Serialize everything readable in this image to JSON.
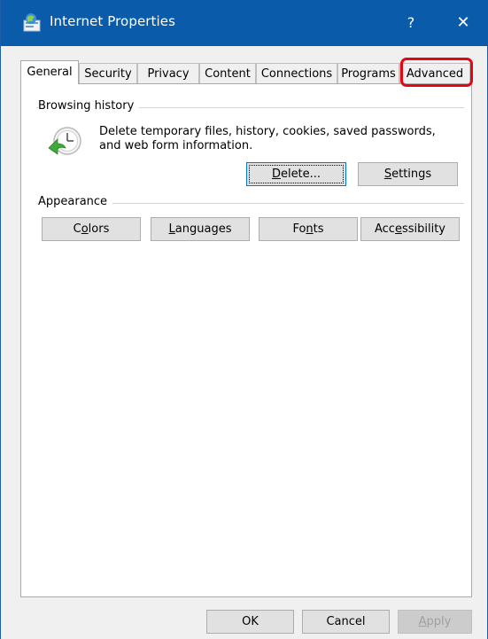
{
  "window": {
    "title": "Internet Properties",
    "help_symbol": "?",
    "close_symbol": "✕",
    "title_icon": "internet-properties-icon"
  },
  "tabs": [
    {
      "label": "General",
      "active": true
    },
    {
      "label": "Security",
      "active": false
    },
    {
      "label": "Privacy",
      "active": false
    },
    {
      "label": "Content",
      "active": false
    },
    {
      "label": "Connections",
      "active": false
    },
    {
      "label": "Programs",
      "active": false
    },
    {
      "label": "Advanced",
      "active": false,
      "highlighted": true
    }
  ],
  "browsing_history": {
    "label": "Browsing history",
    "description": "Delete temporary files, history, cookies, saved passwords, and web form information.",
    "icon": "history-clock-icon",
    "delete_button": {
      "pre": "",
      "key": "D",
      "post": "elete..."
    },
    "settings_button": {
      "pre": "",
      "key": "S",
      "post": "ettings"
    }
  },
  "appearance": {
    "label": "Appearance",
    "colors_button": {
      "pre": "C",
      "key": "o",
      "post": "lors"
    },
    "languages_button": {
      "pre": "",
      "key": "L",
      "post": "anguages"
    },
    "fonts_button": {
      "pre": "Fo",
      "key": "n",
      "post": "ts"
    },
    "accessibility_button": {
      "pre": "Acc",
      "key": "e",
      "post": "ssibility"
    }
  },
  "footer": {
    "ok": "OK",
    "cancel": "Cancel",
    "apply": {
      "pre": "",
      "key": "A",
      "post": "pply"
    }
  },
  "colors": {
    "titlebar": "#0a5cab",
    "highlight": "#e30613",
    "focus": "#0078d7"
  }
}
